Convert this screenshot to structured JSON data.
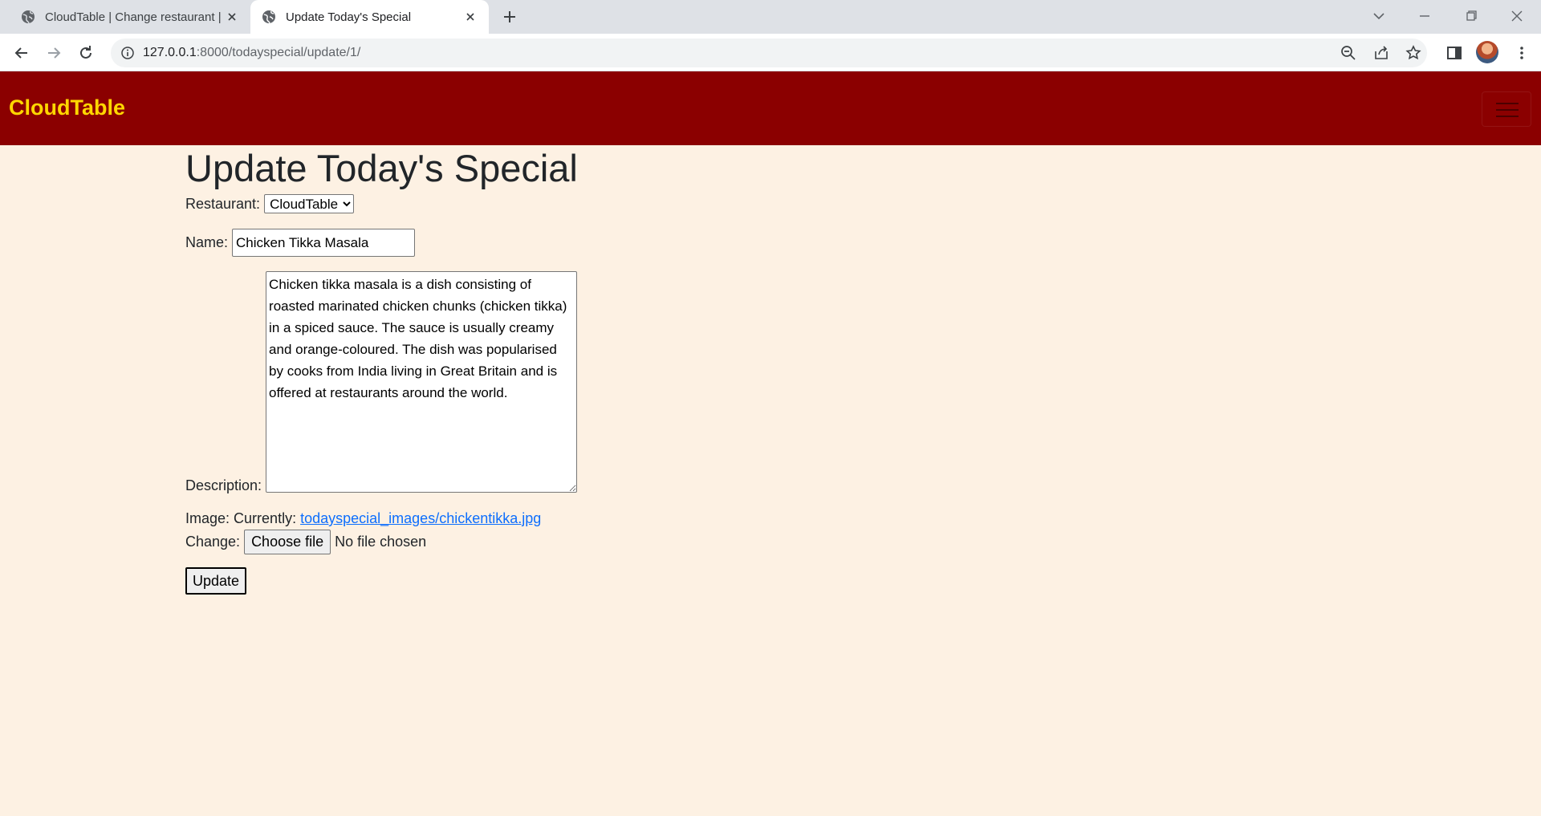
{
  "browser": {
    "tabs": [
      {
        "title": "CloudTable | Change restaurant |"
      },
      {
        "title": "Update Today's Special"
      }
    ],
    "url_host": "127.0.0.1",
    "url_rest": ":8000/todayspecial/update/1/"
  },
  "navbar": {
    "brand": "CloudTable",
    "brand_color": "#ffd700",
    "bar_color": "#8b0000"
  },
  "page": {
    "heading": "Update Today's Special",
    "restaurant_label": "Restaurant:",
    "restaurant_selected": "CloudTable",
    "name_label": "Name:",
    "name_value": "Chicken Tikka Masala",
    "description_label": "Description:",
    "description_value": "Chicken tikka masala is a dish consisting of roasted marinated chicken chunks (chicken tikka) in a spiced sauce. The sauce is usually creamy and orange-coloured. The dish was popularised by cooks from India living in Great Britain and is offered at restaurants around the world.",
    "image_label": "Image:",
    "currently_label": "Currently:",
    "current_file": "todayspecial_images/chickentikka.jpg",
    "change_label": "Change:",
    "choose_file_label": "Choose file",
    "no_file_text": "No file chosen",
    "submit_label": "Update"
  }
}
